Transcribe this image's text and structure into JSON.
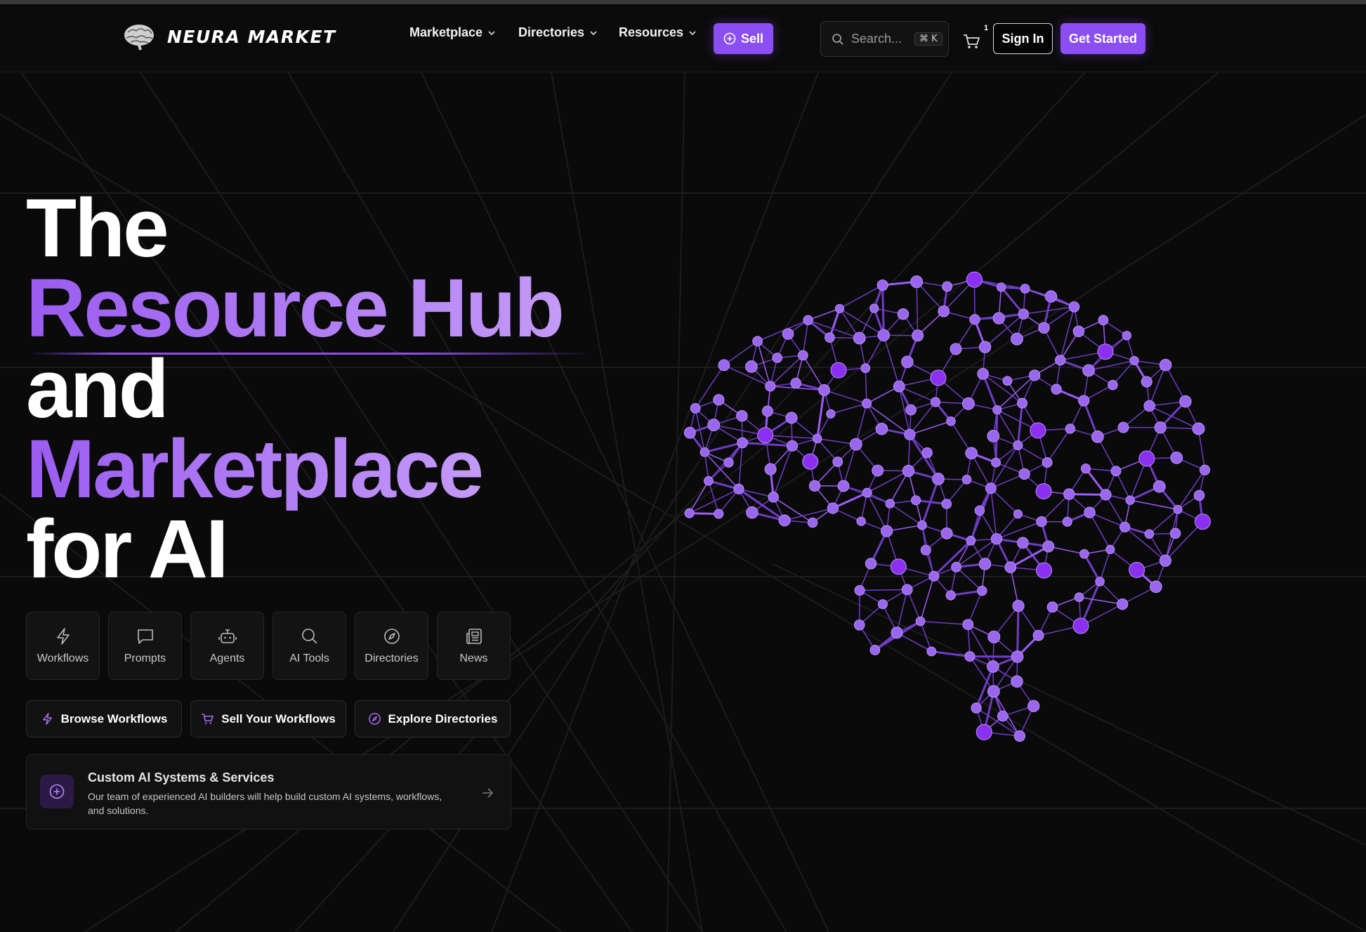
{
  "header": {
    "brand": "NEURA MARKET",
    "nav": [
      {
        "label": "Marketplace"
      },
      {
        "label": "Directories"
      },
      {
        "label": "Resources"
      }
    ],
    "sell_label": "Sell",
    "search_placeholder": "Search...",
    "search_shortcut": "⌘ K",
    "cart_count": "1",
    "signin_label": "Sign In",
    "getstarted_label": "Get Started"
  },
  "hero": {
    "line1": "The",
    "line2": "Resource Hub",
    "line3": "and",
    "line4": "Marketplace",
    "line5": "for AI"
  },
  "categories": [
    {
      "label": "Workflows",
      "icon": "bolt-icon"
    },
    {
      "label": "Prompts",
      "icon": "message-icon"
    },
    {
      "label": "Agents",
      "icon": "bot-icon"
    },
    {
      "label": "AI Tools",
      "icon": "search-icon"
    },
    {
      "label": "Directories",
      "icon": "compass-icon"
    },
    {
      "label": "News",
      "icon": "newspaper-icon"
    }
  ],
  "actions": [
    {
      "label": "Browse Workflows",
      "icon": "bolt-icon"
    },
    {
      "label": "Sell Your Workflows",
      "icon": "cart-icon"
    },
    {
      "label": "Explore Directories",
      "icon": "compass-icon"
    }
  ],
  "custom": {
    "title": "Custom AI Systems & Services",
    "description": "Our team of experienced AI builders will help build custom AI systems, workflows, and solutions."
  },
  "colors": {
    "accent": "#8b4ef2",
    "accent_light": "#b07cf5",
    "background": "#0a0a0a"
  }
}
